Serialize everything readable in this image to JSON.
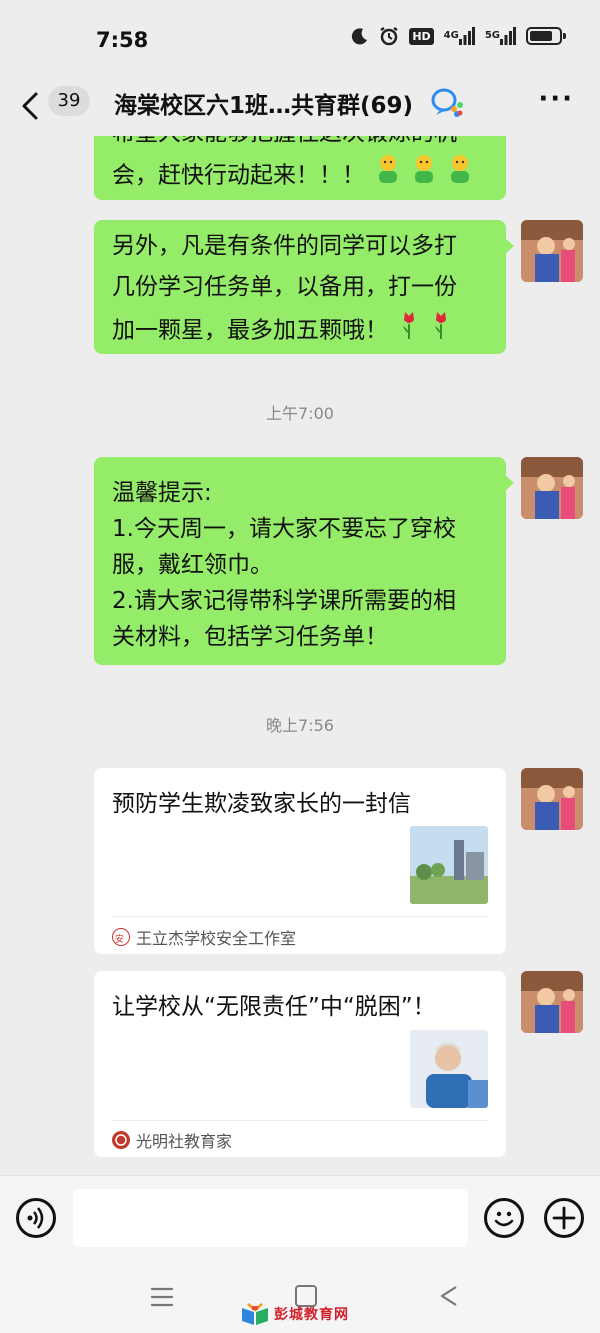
{
  "status_bar": {
    "time": "7:58",
    "hd_label": "HD",
    "net_1": "4G",
    "net_2": "5G",
    "battery_percent": 80,
    "icons": [
      "moon-icon",
      "alarm-icon",
      "hd-icon",
      "signal-icon",
      "signal-icon",
      "battery-icon"
    ]
  },
  "header": {
    "back_count": "39",
    "title": "海棠校区六1班…共育群(69)",
    "more_label": "···"
  },
  "messages": [
    {
      "type": "text",
      "lines": [
        "希望大家能够把握住这次锻炼的机",
        "会，赶快行动起来！！！"
      ],
      "emoji": "🧍🧍🧍"
    },
    {
      "type": "text",
      "lines": [
        "另外，凡是有条件的同学可以多打",
        "几份学习任务单，以备用，打一份",
        "加一颗星，最多加五颗哦！"
      ],
      "emoji": "🌷🌷"
    },
    {
      "type": "time",
      "text": "上午7:00"
    },
    {
      "type": "text",
      "lines": [
        "温馨提示:",
        "1.今天周一，请大家不要忘了穿校",
        "服，戴红领巾。",
        "2.请大家记得带科学课所需要的相",
        "关材料，包括学习任务单！"
      ]
    },
    {
      "type": "time",
      "text": "晚上7:56"
    },
    {
      "type": "card",
      "title": "预防学生欺凌致家长的一封信",
      "source": "王立杰学校安全工作室"
    },
    {
      "type": "card",
      "title": "让学校从“无限责任”中“脱困”！",
      "source": "光明社教育家"
    }
  ],
  "input_bar": {
    "placeholder": ""
  },
  "watermark": {
    "text": "彭城教育网"
  },
  "colors": {
    "bubble_green": "#95ec69",
    "background": "#ededed",
    "watermark_red": "#d21f2b"
  }
}
